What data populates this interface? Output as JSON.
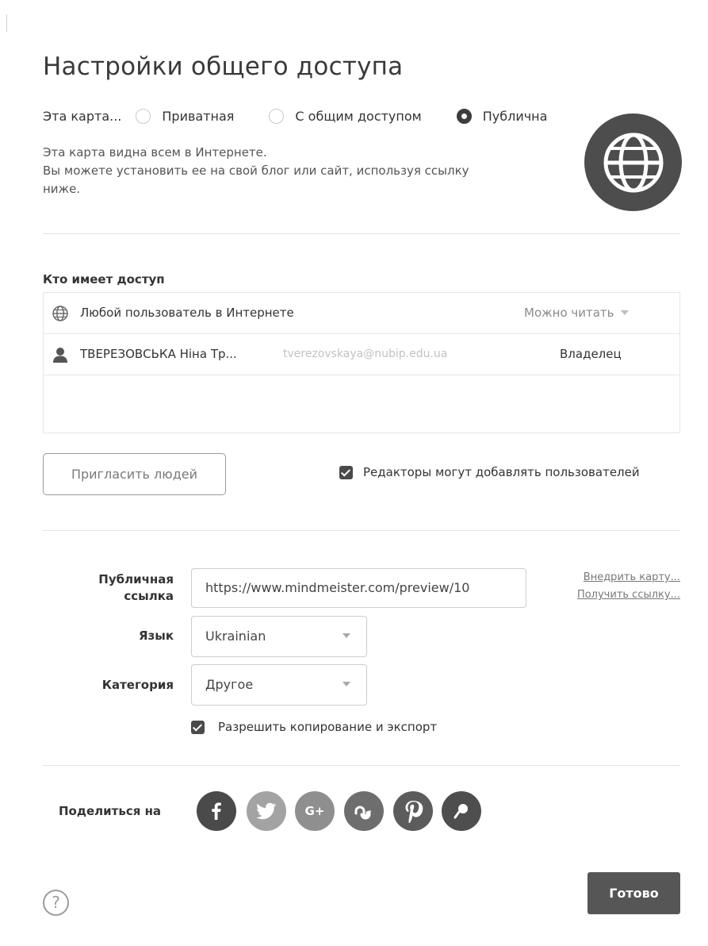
{
  "dialog": {
    "title": "Настройки общего доступа"
  },
  "privacy": {
    "label": "Эта карта...",
    "options": [
      {
        "label": "Приватная",
        "selected": false
      },
      {
        "label": "С общим доступом",
        "selected": false
      },
      {
        "label": "Публична",
        "selected": true
      }
    ],
    "description_line1": "Эта карта видна всем в Интернете.",
    "description_line2": "Вы можете установить ее на свой блог или сайт, используя ссылку",
    "description_line3": "ниже.",
    "badge_icon": "globe-icon"
  },
  "access": {
    "heading": "Кто имеет доступ",
    "rows": [
      {
        "icon": "globe-icon",
        "name": "Любой пользователь в Интернете",
        "permission": "Можно читать"
      },
      {
        "icon": "user-icon",
        "name": "ТВЕРЕЗОВСЬКА Ніна Тр...",
        "email": "tverezovskaya@nubip.edu.ua",
        "role": "Владелец"
      }
    ]
  },
  "invite": {
    "button_label": "Пригласить людей",
    "editors_checkbox_label": "Редакторы могут добавлять пользователей",
    "editors_checked": true
  },
  "public_settings": {
    "link_label_line1": "Публичная",
    "link_label_line2": "ссылка",
    "link_value": "https://www.mindmeister.com/preview/10",
    "embed_link": "Внедрить карту...",
    "get_link": "Получить ссылку...",
    "language_label": "Язык",
    "language_value": "Ukrainian",
    "category_label": "Категория",
    "category_value": "Другое",
    "copy_checkbox_label": "Разрешить копирование и экспорт",
    "copy_checked": true
  },
  "share": {
    "label": "Поделиться на",
    "networks": [
      {
        "icon": "facebook-icon",
        "glyph": "f",
        "color": "#4a4a4a"
      },
      {
        "icon": "twitter-icon",
        "glyph": "",
        "color": "#a3a3a3"
      },
      {
        "icon": "google-plus-icon",
        "glyph": "G+",
        "color": "#8f8f8f"
      },
      {
        "icon": "stumbleupon-icon",
        "glyph": "",
        "color": "#6e6e6e"
      },
      {
        "icon": "pinterest-icon",
        "glyph": "",
        "color": "#5c5c5c"
      },
      {
        "icon": "delicious-icon",
        "glyph": "",
        "color": "#4e4e4e"
      }
    ]
  },
  "footer": {
    "help_glyph": "?",
    "done_label": "Готово"
  }
}
